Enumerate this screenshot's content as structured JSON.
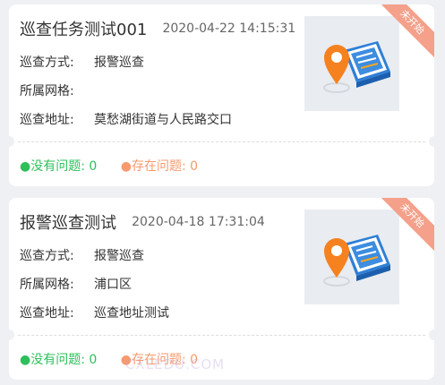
{
  "tasks": [
    {
      "title": "巡查任务测试001",
      "datetime": "2020-04-22 14:15:31",
      "status": "未开始",
      "method_label": "巡查方式:",
      "method_value": "报警巡查",
      "grid_label": "所属网格:",
      "grid_value": "",
      "address_label": "巡查地址:",
      "address_value": "莫愁湖街道与人民路交口",
      "no_issue_label": "●没有问题: 0",
      "has_issue_label": "●存在问题: 0"
    },
    {
      "title": "报警巡查测试",
      "datetime": "2020-04-18 17:31:04",
      "status": "未开始",
      "method_label": "巡查方式:",
      "method_value": "报警巡查",
      "grid_label": "所属网格:",
      "grid_value": "浦口区",
      "address_label": "巡查地址:",
      "address_value": "巡查地址测试",
      "no_issue_label": "●没有问题: 0",
      "has_issue_label": "●存在问题: 0"
    }
  ],
  "watermark": "CXLEDU.COM",
  "colors": {
    "background": "#eef0f3",
    "ok": "#2ebf5a",
    "issue": "#f79a6e",
    "ribbon": "#f4a08a",
    "pin": "#f5821f",
    "book": "#2f7fd6"
  },
  "icons": [
    "location-pin-icon",
    "book-icon"
  ]
}
